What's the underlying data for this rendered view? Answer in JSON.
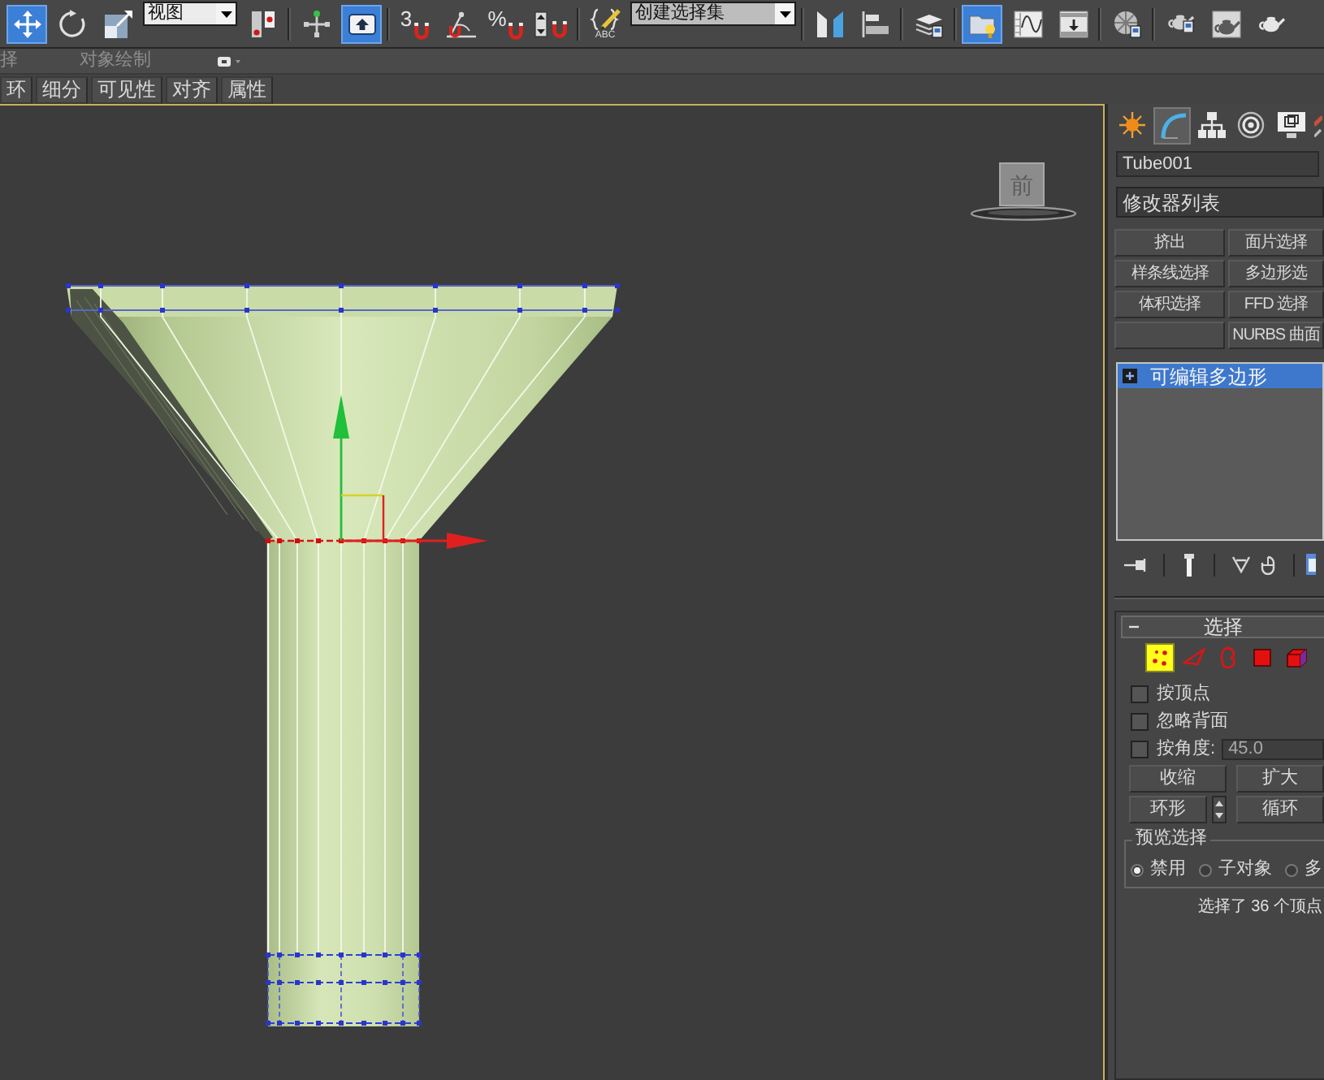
{
  "toolbar": {
    "items": [
      {
        "kind": "move",
        "selected": true
      },
      {
        "kind": "rotate",
        "selected": false
      },
      {
        "kind": "scale",
        "selected": false
      },
      {
        "kind": "dropdown",
        "value": "视图"
      },
      {
        "kind": "pivot",
        "selected": false
      },
      {
        "kind": "separator"
      },
      {
        "kind": "manipulate",
        "selected": false
      },
      {
        "kind": "keyboard",
        "selected": true
      },
      {
        "kind": "separator"
      },
      {
        "kind": "snap",
        "label": "3",
        "selected": false
      },
      {
        "kind": "angle",
        "selected": false
      },
      {
        "kind": "percent",
        "label": "%",
        "selected": false
      },
      {
        "kind": "spinner",
        "selected": false
      },
      {
        "kind": "separator"
      },
      {
        "kind": "sets",
        "label": "ABC",
        "selected": false
      },
      {
        "kind": "dropdown",
        "value": "创建选择集"
      },
      {
        "kind": "separator"
      },
      {
        "kind": "mirror",
        "selected": false
      },
      {
        "kind": "align",
        "selected": false
      },
      {
        "kind": "separator"
      },
      {
        "kind": "layers",
        "selected": false
      },
      {
        "kind": "separator"
      },
      {
        "kind": "explorer",
        "selected": true
      },
      {
        "kind": "curves",
        "selected": false
      },
      {
        "kind": "schematic",
        "selected": false
      },
      {
        "kind": "separator"
      },
      {
        "kind": "material",
        "selected": false
      },
      {
        "kind": "separator"
      },
      {
        "kind": "setup",
        "selected": false
      },
      {
        "kind": "frame",
        "selected": false
      },
      {
        "kind": "render",
        "selected": false
      }
    ]
  },
  "ribbon": {
    "tab_fragment": "择",
    "panel_label": "对象绘制",
    "buttons": [
      "环",
      "细分",
      "可见性",
      "对齐",
      "属性"
    ]
  },
  "viewport": {
    "active": true,
    "viewcube_label": "前"
  },
  "command_panel": {
    "tabs": [
      {
        "kind": "create",
        "selected": false
      },
      {
        "kind": "modify",
        "selected": true
      },
      {
        "kind": "hierarchy",
        "selected": false
      },
      {
        "kind": "motion",
        "selected": false
      },
      {
        "kind": "display",
        "selected": false
      },
      {
        "kind": "utilities",
        "selected": false
      }
    ],
    "object_name": "Tube001",
    "modifier_list": "修改器列表",
    "modifier_buttons": [
      {
        "kind": "text",
        "label": "挤出"
      },
      {
        "kind": "text",
        "label": "面片选择"
      },
      {
        "kind": "text",
        "label": "样条线选择"
      },
      {
        "kind": "text",
        "label": "多边形选"
      },
      {
        "kind": "text",
        "label": "体积选择"
      },
      {
        "kind": "text",
        "label": "FFD 选择"
      },
      {
        "kind": "blank"
      },
      {
        "kind": "text",
        "label": "NURBS 曲面"
      }
    ],
    "stack": [
      {
        "label": "可编辑多边形",
        "selected": true,
        "expanded": false
      }
    ],
    "selection_rollout": {
      "title": "选择",
      "expanded": true,
      "levels": [
        {
          "kind": "vertex",
          "selected": true
        },
        {
          "kind": "edge",
          "selected": false
        },
        {
          "kind": "border",
          "selected": false
        },
        {
          "kind": "polygon",
          "selected": false
        },
        {
          "kind": "element",
          "selected": false
        }
      ],
      "checkboxes": [
        {
          "label": "按顶点",
          "checked": false
        },
        {
          "label": "忽略背面",
          "checked": false
        },
        {
          "label": "按角度:",
          "checked": false
        }
      ],
      "angle_value": "45.0",
      "buttons": [
        "收缩",
        "扩大",
        "环形",
        "循环"
      ],
      "preview": {
        "title": "预览选择",
        "options": [
          {
            "label": "禁用",
            "selected": true
          },
          {
            "label": "子对象",
            "selected": false
          },
          {
            "label": "多",
            "selected": false
          }
        ]
      },
      "status": "选择了 36 个顶点"
    }
  }
}
